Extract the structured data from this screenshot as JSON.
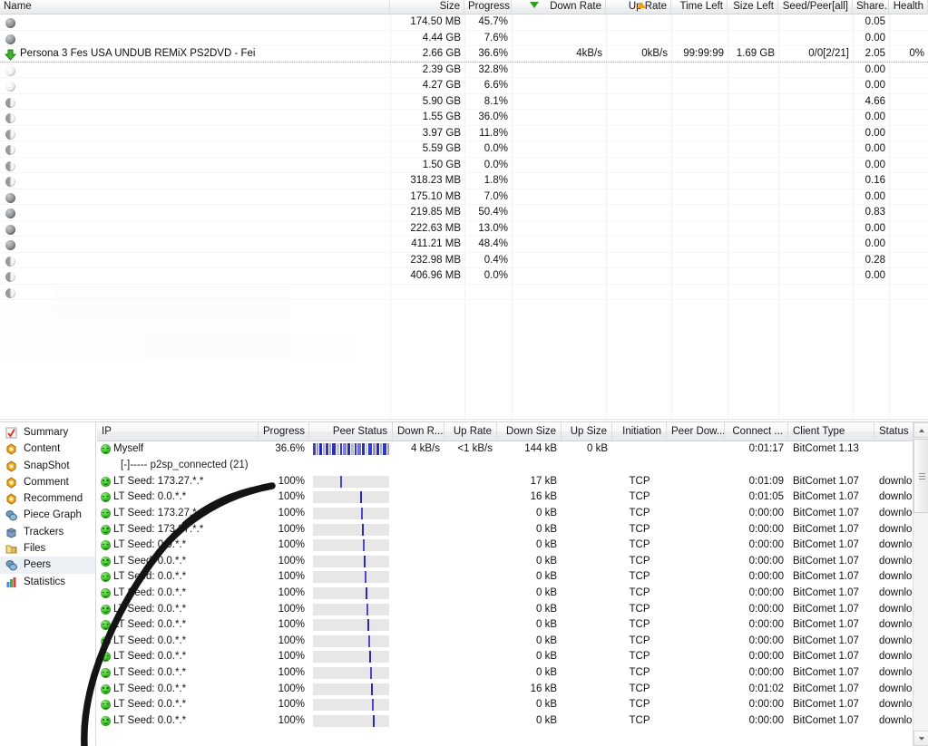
{
  "app": {
    "name": "BitComet",
    "accent_green": "#2f9e20",
    "accent_orange": "#e8a317",
    "bar_blue": "#2a2ab0"
  },
  "torrent_list": {
    "columns": [
      {
        "key": "name",
        "label": "Name",
        "align": "left"
      },
      {
        "key": "size",
        "label": "Size",
        "align": "right"
      },
      {
        "key": "progress",
        "label": "Progress",
        "align": "right"
      },
      {
        "key": "down",
        "label": "Down Rate",
        "align": "right"
      },
      {
        "key": "up",
        "label": "Up Rate",
        "align": "right"
      },
      {
        "key": "time",
        "label": "Time Left",
        "align": "right"
      },
      {
        "key": "sizeleft",
        "label": "Size Left",
        "align": "right"
      },
      {
        "key": "seedpeer",
        "label": "Seed/Peer[all]",
        "align": "right"
      },
      {
        "key": "share",
        "label": "Share...",
        "align": "right"
      },
      {
        "key": "health",
        "label": "Health",
        "align": "right"
      }
    ],
    "rows": [
      {
        "icon": "gray-sphere-icon",
        "name": "",
        "size": "174.50 MB",
        "progress": "45.7%",
        "down": "",
        "up": "",
        "time": "",
        "sizeleft": "",
        "seedpeer": "",
        "share": "0.05",
        "health": ""
      },
      {
        "icon": "gray-sphere-icon",
        "name": "",
        "size": "4.44 GB",
        "progress": "7.6%",
        "down": "",
        "up": "",
        "time": "",
        "sizeleft": "",
        "seedpeer": "",
        "share": "0.00",
        "health": ""
      },
      {
        "icon": "download-arrow-icon",
        "name": "Persona 3 Fes USA UNDUB REMiX PS2DVD - Fei",
        "size": "2.66 GB",
        "progress": "36.6%",
        "down": "4kB/s",
        "up": "0kB/s",
        "time": "99:99:99",
        "sizeleft": "1.69 GB",
        "seedpeer": "0/0[2/21]",
        "share": "2.05",
        "health": "0%",
        "selected": true
      },
      {
        "icon": "gray-sphere-icon",
        "name": "",
        "size": "2.39 GB",
        "progress": "32.8%",
        "down": "",
        "up": "",
        "time": "",
        "sizeleft": "",
        "seedpeer": "",
        "share": "0.00",
        "health": ""
      },
      {
        "icon": "gray-sphere-icon",
        "name": "",
        "size": "4.27 GB",
        "progress": "6.6%",
        "down": "",
        "up": "",
        "time": "",
        "sizeleft": "",
        "seedpeer": "",
        "share": "0.00",
        "health": ""
      },
      {
        "icon": "gray-sphere-icon",
        "name": "",
        "size": "5.90 GB",
        "progress": "8.1%",
        "down": "",
        "up": "",
        "time": "",
        "sizeleft": "",
        "seedpeer": "",
        "share": "4.66",
        "health": ""
      },
      {
        "icon": "gray-sphere-icon",
        "name": "",
        "size": "1.55 GB",
        "progress": "36.0%",
        "down": "",
        "up": "",
        "time": "",
        "sizeleft": "",
        "seedpeer": "",
        "share": "0.00",
        "health": ""
      },
      {
        "icon": "gray-sphere-icon",
        "name": "",
        "size": "3.97 GB",
        "progress": "11.8%",
        "down": "",
        "up": "",
        "time": "",
        "sizeleft": "",
        "seedpeer": "",
        "share": "0.00",
        "health": ""
      },
      {
        "icon": "gray-sphere-icon",
        "name": "",
        "size": "5.59 GB",
        "progress": "0.0%",
        "down": "",
        "up": "",
        "time": "",
        "sizeleft": "",
        "seedpeer": "",
        "share": "0.00",
        "health": ""
      },
      {
        "icon": "gray-sphere-icon",
        "name": "",
        "size": "1.50 GB",
        "progress": "0.0%",
        "down": "",
        "up": "",
        "time": "",
        "sizeleft": "",
        "seedpeer": "",
        "share": "0.00",
        "health": ""
      },
      {
        "icon": "gray-sphere-icon",
        "name": "",
        "size": "318.23 MB",
        "progress": "1.8%",
        "down": "",
        "up": "",
        "time": "",
        "sizeleft": "",
        "seedpeer": "",
        "share": "0.16",
        "health": ""
      },
      {
        "icon": "gray-sphere-icon",
        "name": "",
        "size": "175.10 MB",
        "progress": "7.0%",
        "down": "",
        "up": "",
        "time": "",
        "sizeleft": "",
        "seedpeer": "",
        "share": "0.00",
        "health": ""
      },
      {
        "icon": "gray-sphere-icon",
        "name": "",
        "size": "219.85 MB",
        "progress": "50.4%",
        "down": "",
        "up": "",
        "time": "",
        "sizeleft": "",
        "seedpeer": "",
        "share": "0.83",
        "health": ""
      },
      {
        "icon": "gray-sphere-icon",
        "name": "",
        "size": "222.63 MB",
        "progress": "13.0%",
        "down": "",
        "up": "",
        "time": "",
        "sizeleft": "",
        "seedpeer": "",
        "share": "0.00",
        "health": ""
      },
      {
        "icon": "gray-sphere-icon",
        "name": "",
        "size": "411.21 MB",
        "progress": "48.4%",
        "down": "",
        "up": "",
        "time": "",
        "sizeleft": "",
        "seedpeer": "",
        "share": "0.00",
        "health": ""
      },
      {
        "icon": "gray-sphere-icon",
        "name": "",
        "size": "232.98 MB",
        "progress": "0.4%",
        "down": "",
        "up": "",
        "time": "",
        "sizeleft": "",
        "seedpeer": "",
        "share": "0.28",
        "health": ""
      },
      {
        "icon": "gray-sphere-icon",
        "name": "",
        "size": "406.96 MB",
        "progress": "0.0%",
        "down": "",
        "up": "",
        "time": "",
        "sizeleft": "",
        "seedpeer": "",
        "share": "0.00",
        "health": ""
      },
      {
        "icon": "gray-sphere-icon",
        "name": "",
        "size": "",
        "progress": "",
        "down": "",
        "up": "",
        "time": "",
        "sizeleft": "",
        "seedpeer": "",
        "share": "",
        "health": ""
      }
    ]
  },
  "sidebar": {
    "items": [
      {
        "label": "Summary",
        "icon": "summary-check-icon"
      },
      {
        "label": "Content",
        "icon": "content-gem-icon"
      },
      {
        "label": "SnapShot",
        "icon": "snapshot-gem-icon"
      },
      {
        "label": "Comment",
        "icon": "comment-gem-icon"
      },
      {
        "label": "Recommend",
        "icon": "recommend-gem-icon"
      },
      {
        "label": "Piece Graph",
        "icon": "piece-graph-icon"
      },
      {
        "label": "Trackers",
        "icon": "trackers-icon"
      },
      {
        "label": "Files",
        "icon": "files-folder-icon"
      },
      {
        "label": "Peers",
        "icon": "peers-icon",
        "active": true
      },
      {
        "label": "Statistics",
        "icon": "statistics-chart-icon"
      }
    ]
  },
  "peers": {
    "columns": [
      {
        "key": "ip",
        "label": "IP",
        "align": "left"
      },
      {
        "key": "progress",
        "label": "Progress",
        "align": "right"
      },
      {
        "key": "status",
        "label": "Peer Status",
        "align": "right"
      },
      {
        "key": "downrate",
        "label": "Down R...",
        "align": "right"
      },
      {
        "key": "uprate",
        "label": "Up Rate",
        "align": "right"
      },
      {
        "key": "downsize",
        "label": "Down Size",
        "align": "right"
      },
      {
        "key": "upsize",
        "label": "Up Size",
        "align": "right"
      },
      {
        "key": "init",
        "label": "Initiation",
        "align": "right"
      },
      {
        "key": "peerdown",
        "label": "Peer Dow...",
        "align": "right"
      },
      {
        "key": "connect",
        "label": "Connect ...",
        "align": "right"
      },
      {
        "key": "client",
        "label": "Client Type",
        "align": "left"
      },
      {
        "key": "status2",
        "label": "Status",
        "align": "left"
      }
    ],
    "rows": [
      {
        "type": "self",
        "icon": "green-smiley-icon",
        "ip": "Myself",
        "progress": "36.6%",
        "downrate": "4 kB/s",
        "uprate": "<1 kB/s",
        "downsize": "144 kB",
        "upsize": "0 kB",
        "init": "",
        "peerdown": "",
        "connect": "0:01:17",
        "client": "BitComet 1.13",
        "status2": ""
      },
      {
        "type": "group",
        "ip": "[-]----- p2sp_connected (21)"
      },
      {
        "type": "peer",
        "icon": "green-smiley-icon",
        "ip": "LT Seed: 173.27.*.*",
        "progress": "100%",
        "downrate": "",
        "uprate": "",
        "downsize": "17 kB",
        "upsize": "",
        "init": "TCP",
        "peerdown": "",
        "connect": "0:01:09",
        "client": "BitComet 1.07",
        "status2": "downloadin"
      },
      {
        "type": "peer",
        "icon": "green-smiley-icon",
        "ip": "LT Seed: 0.0.*.*",
        "progress": "100%",
        "downrate": "",
        "uprate": "",
        "downsize": "16 kB",
        "upsize": "",
        "init": "TCP",
        "peerdown": "",
        "connect": "0:01:05",
        "client": "BitComet 1.07",
        "status2": "downloadin"
      },
      {
        "type": "peer",
        "icon": "green-smiley-icon",
        "ip": "LT Seed: 173.27.*.*",
        "progress": "100%",
        "downrate": "",
        "uprate": "",
        "downsize": "0 kB",
        "upsize": "",
        "init": "TCP",
        "peerdown": "",
        "connect": "0:00:00",
        "client": "BitComet 1.07",
        "status2": "downloadin"
      },
      {
        "type": "peer",
        "icon": "green-smiley-icon",
        "ip": "LT Seed: 173.27.*.*",
        "progress": "100%",
        "downrate": "",
        "uprate": "",
        "downsize": "0 kB",
        "upsize": "",
        "init": "TCP",
        "peerdown": "",
        "connect": "0:00:00",
        "client": "BitComet 1.07",
        "status2": "downloadin"
      },
      {
        "type": "peer",
        "icon": "green-smiley-icon",
        "ip": "LT Seed: 0.0.*.*",
        "progress": "100%",
        "downrate": "",
        "uprate": "",
        "downsize": "0 kB",
        "upsize": "",
        "init": "TCP",
        "peerdown": "",
        "connect": "0:00:00",
        "client": "BitComet 1.07",
        "status2": "downloadin"
      },
      {
        "type": "peer",
        "icon": "green-smiley-icon",
        "ip": "LT Seed: 0.0.*.*",
        "progress": "100%",
        "downrate": "",
        "uprate": "",
        "downsize": "0 kB",
        "upsize": "",
        "init": "TCP",
        "peerdown": "",
        "connect": "0:00:00",
        "client": "BitComet 1.07",
        "status2": "downloadin"
      },
      {
        "type": "peer",
        "icon": "green-smiley-icon",
        "ip": "LT Seed: 0.0.*.*",
        "progress": "100%",
        "downrate": "",
        "uprate": "",
        "downsize": "0 kB",
        "upsize": "",
        "init": "TCP",
        "peerdown": "",
        "connect": "0:00:00",
        "client": "BitComet 1.07",
        "status2": "downloadin"
      },
      {
        "type": "peer",
        "icon": "green-smiley-icon",
        "ip": "LT Seed: 0.0.*.*",
        "progress": "100%",
        "downrate": "",
        "uprate": "",
        "downsize": "0 kB",
        "upsize": "",
        "init": "TCP",
        "peerdown": "",
        "connect": "0:00:00",
        "client": "BitComet 1.07",
        "status2": "downloadin"
      },
      {
        "type": "peer",
        "icon": "green-smiley-icon",
        "ip": "LT Seed: 0.0.*.*",
        "progress": "100%",
        "downrate": "",
        "uprate": "",
        "downsize": "0 kB",
        "upsize": "",
        "init": "TCP",
        "peerdown": "",
        "connect": "0:00:00",
        "client": "BitComet 1.07",
        "status2": "downloadin"
      },
      {
        "type": "peer",
        "icon": "green-smiley-icon",
        "ip": "LT Seed: 0.0.*.*",
        "progress": "100%",
        "downrate": "",
        "uprate": "",
        "downsize": "0 kB",
        "upsize": "",
        "init": "TCP",
        "peerdown": "",
        "connect": "0:00:00",
        "client": "BitComet 1.07",
        "status2": "downloadin"
      },
      {
        "type": "peer",
        "icon": "green-smiley-icon",
        "ip": "LT Seed: 0.0.*.*",
        "progress": "100%",
        "downrate": "",
        "uprate": "",
        "downsize": "0 kB",
        "upsize": "",
        "init": "TCP",
        "peerdown": "",
        "connect": "0:00:00",
        "client": "BitComet 1.07",
        "status2": "downloadin"
      },
      {
        "type": "peer",
        "icon": "green-smiley-icon",
        "ip": "LT Seed: 0.0.*.*",
        "progress": "100%",
        "downrate": "",
        "uprate": "",
        "downsize": "0 kB",
        "upsize": "",
        "init": "TCP",
        "peerdown": "",
        "connect": "0:00:00",
        "client": "BitComet 1.07",
        "status2": "downloadin"
      },
      {
        "type": "peer",
        "icon": "green-smiley-icon",
        "ip": "LT Seed: 0.0.*.*",
        "progress": "100%",
        "downrate": "",
        "uprate": "",
        "downsize": "0 kB",
        "upsize": "",
        "init": "TCP",
        "peerdown": "",
        "connect": "0:00:00",
        "client": "BitComet 1.07",
        "status2": "downloadin"
      },
      {
        "type": "peer",
        "icon": "green-smiley-icon",
        "ip": "LT Seed: 0.0.*.*",
        "progress": "100%",
        "downrate": "",
        "uprate": "",
        "downsize": "16 kB",
        "upsize": "",
        "init": "TCP",
        "peerdown": "",
        "connect": "0:01:02",
        "client": "BitComet 1.07",
        "status2": "downloadin"
      },
      {
        "type": "peer",
        "icon": "green-smiley-icon",
        "ip": "LT Seed: 0.0.*.*",
        "progress": "100%",
        "downrate": "",
        "uprate": "",
        "downsize": "0 kB",
        "upsize": "",
        "init": "TCP",
        "peerdown": "",
        "connect": "0:00:00",
        "client": "BitComet 1.07",
        "status2": "downloadin"
      },
      {
        "type": "peer",
        "icon": "green-smiley-icon",
        "ip": "LT Seed: 0.0.*.*",
        "progress": "100%",
        "downrate": "",
        "uprate": "",
        "downsize": "0 kB",
        "upsize": "",
        "init": "TCP",
        "peerdown": "",
        "connect": "0:00:00",
        "client": "BitComet 1.07",
        "status2": "downloadin"
      }
    ]
  },
  "scrollbar": {
    "up_icon": "scroll-up-arrow-icon",
    "down_icon": "scroll-down-arrow-icon",
    "thumb": "scroll-thumb"
  },
  "annotation": {
    "type": "handdrawn-curve",
    "color": "#111111"
  }
}
